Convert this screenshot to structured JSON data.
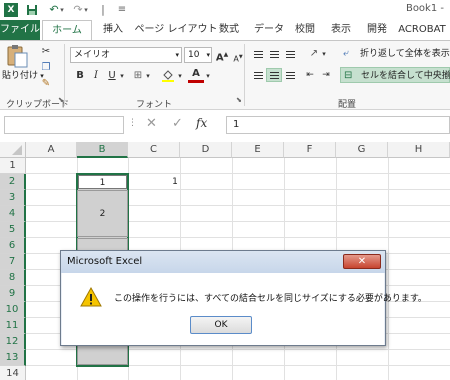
{
  "app": {
    "logo": "X",
    "book_title": "Book1 -"
  },
  "qat": {
    "save_icon": "save-icon",
    "undo_icon": "undo-icon",
    "redo_icon": "redo-icon",
    "more": "≡"
  },
  "tabs": [
    "ファイル",
    "ホーム",
    "挿入",
    "ページ レイアウト",
    "数式",
    "データ",
    "校閲",
    "表示",
    "開発",
    "ACROBAT"
  ],
  "clipboard": {
    "paste_label": "貼り付け",
    "group_label": "クリップボード"
  },
  "font": {
    "name": "メイリオ",
    "size": "10",
    "grow": "A",
    "shrink": "A",
    "bold": "B",
    "italic": "I",
    "underline": "U",
    "group_label": "フォント",
    "font_color": "#c00000"
  },
  "alignment": {
    "wrap_label": "折り返して全体を表示する",
    "merge_label": "セルを結合して中央揃え",
    "group_label": "配置"
  },
  "formula_bar": {
    "fx": "fx",
    "value": "1"
  },
  "columns": [
    "A",
    "B",
    "C",
    "D",
    "E",
    "F",
    "G",
    "H"
  ],
  "rows": [
    "1",
    "2",
    "3",
    "4",
    "5",
    "6",
    "7",
    "8",
    "9",
    "10",
    "11",
    "12",
    "13",
    "14"
  ],
  "cells": {
    "b2": "1",
    "b3": "2",
    "c2": "1"
  },
  "dialog": {
    "title": "Microsoft Excel",
    "close": "✕",
    "message": "この操作を行うには、すべての結合セルを同じサイズにする必要があります。",
    "ok": "OK"
  },
  "colors": {
    "accent": "#217346",
    "selected_fill": "#d0d0d0"
  }
}
